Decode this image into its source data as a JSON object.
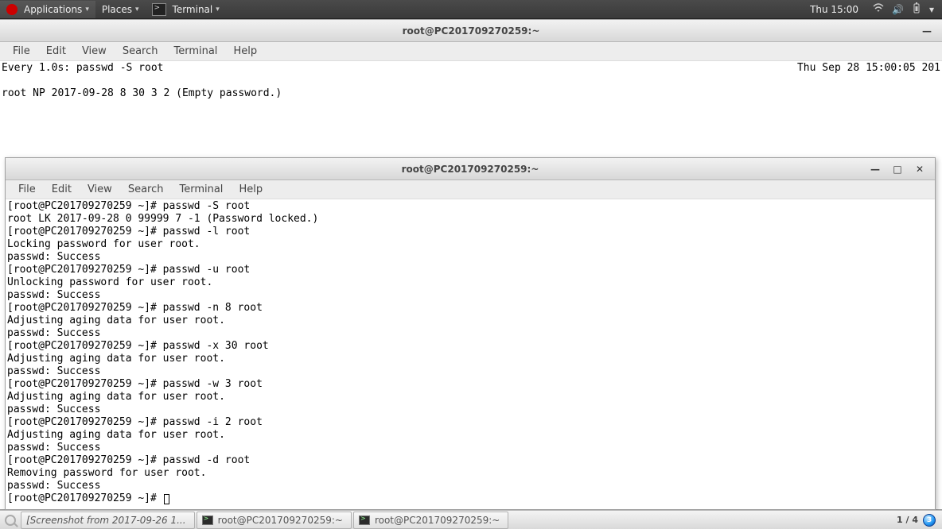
{
  "panel": {
    "applications": "Applications",
    "places": "Places",
    "active_app": "Terminal",
    "clock": "Thu 15:00"
  },
  "win_back": {
    "title": "root@PC201709270259:~",
    "menu": {
      "file": "File",
      "edit": "Edit",
      "view": "View",
      "search": "Search",
      "terminal": "Terminal",
      "help": "Help"
    },
    "line_watch": "Every 1.0s: passwd -S root",
    "line_time": "Thu Sep 28 15:00:05 201",
    "line_status": "root NP 2017-09-28 8 30 3 2 (Empty password.)"
  },
  "win_front": {
    "title": "root@PC201709270259:~",
    "menu": {
      "file": "File",
      "edit": "Edit",
      "view": "View",
      "search": "Search",
      "terminal": "Terminal",
      "help": "Help"
    },
    "lines": [
      "[root@PC201709270259 ~]# passwd -S root",
      "root LK 2017-09-28 0 99999 7 -1 (Password locked.)",
      "[root@PC201709270259 ~]# passwd -l root",
      "Locking password for user root.",
      "passwd: Success",
      "[root@PC201709270259 ~]# passwd -u root",
      "Unlocking password for user root.",
      "passwd: Success",
      "[root@PC201709270259 ~]# passwd -n 8 root",
      "Adjusting aging data for user root.",
      "passwd: Success",
      "[root@PC201709270259 ~]# passwd -x 30 root",
      "Adjusting aging data for user root.",
      "passwd: Success",
      "[root@PC201709270259 ~]# passwd -w 3 root",
      "Adjusting aging data for user root.",
      "passwd: Success",
      "[root@PC201709270259 ~]# passwd -i 2 root",
      "Adjusting aging data for user root.",
      "passwd: Success",
      "[root@PC201709270259 ~]# passwd -d root",
      "Removing password for user root.",
      "passwd: Success"
    ],
    "prompt_last": "[root@PC201709270259 ~]# "
  },
  "bottom": {
    "task1": "[Screenshot from 2017-09-26 1...",
    "task2": "root@PC201709270259:~",
    "task3": "root@PC201709270259:~",
    "workspace": "1 / 4",
    "notif_count": "3"
  }
}
